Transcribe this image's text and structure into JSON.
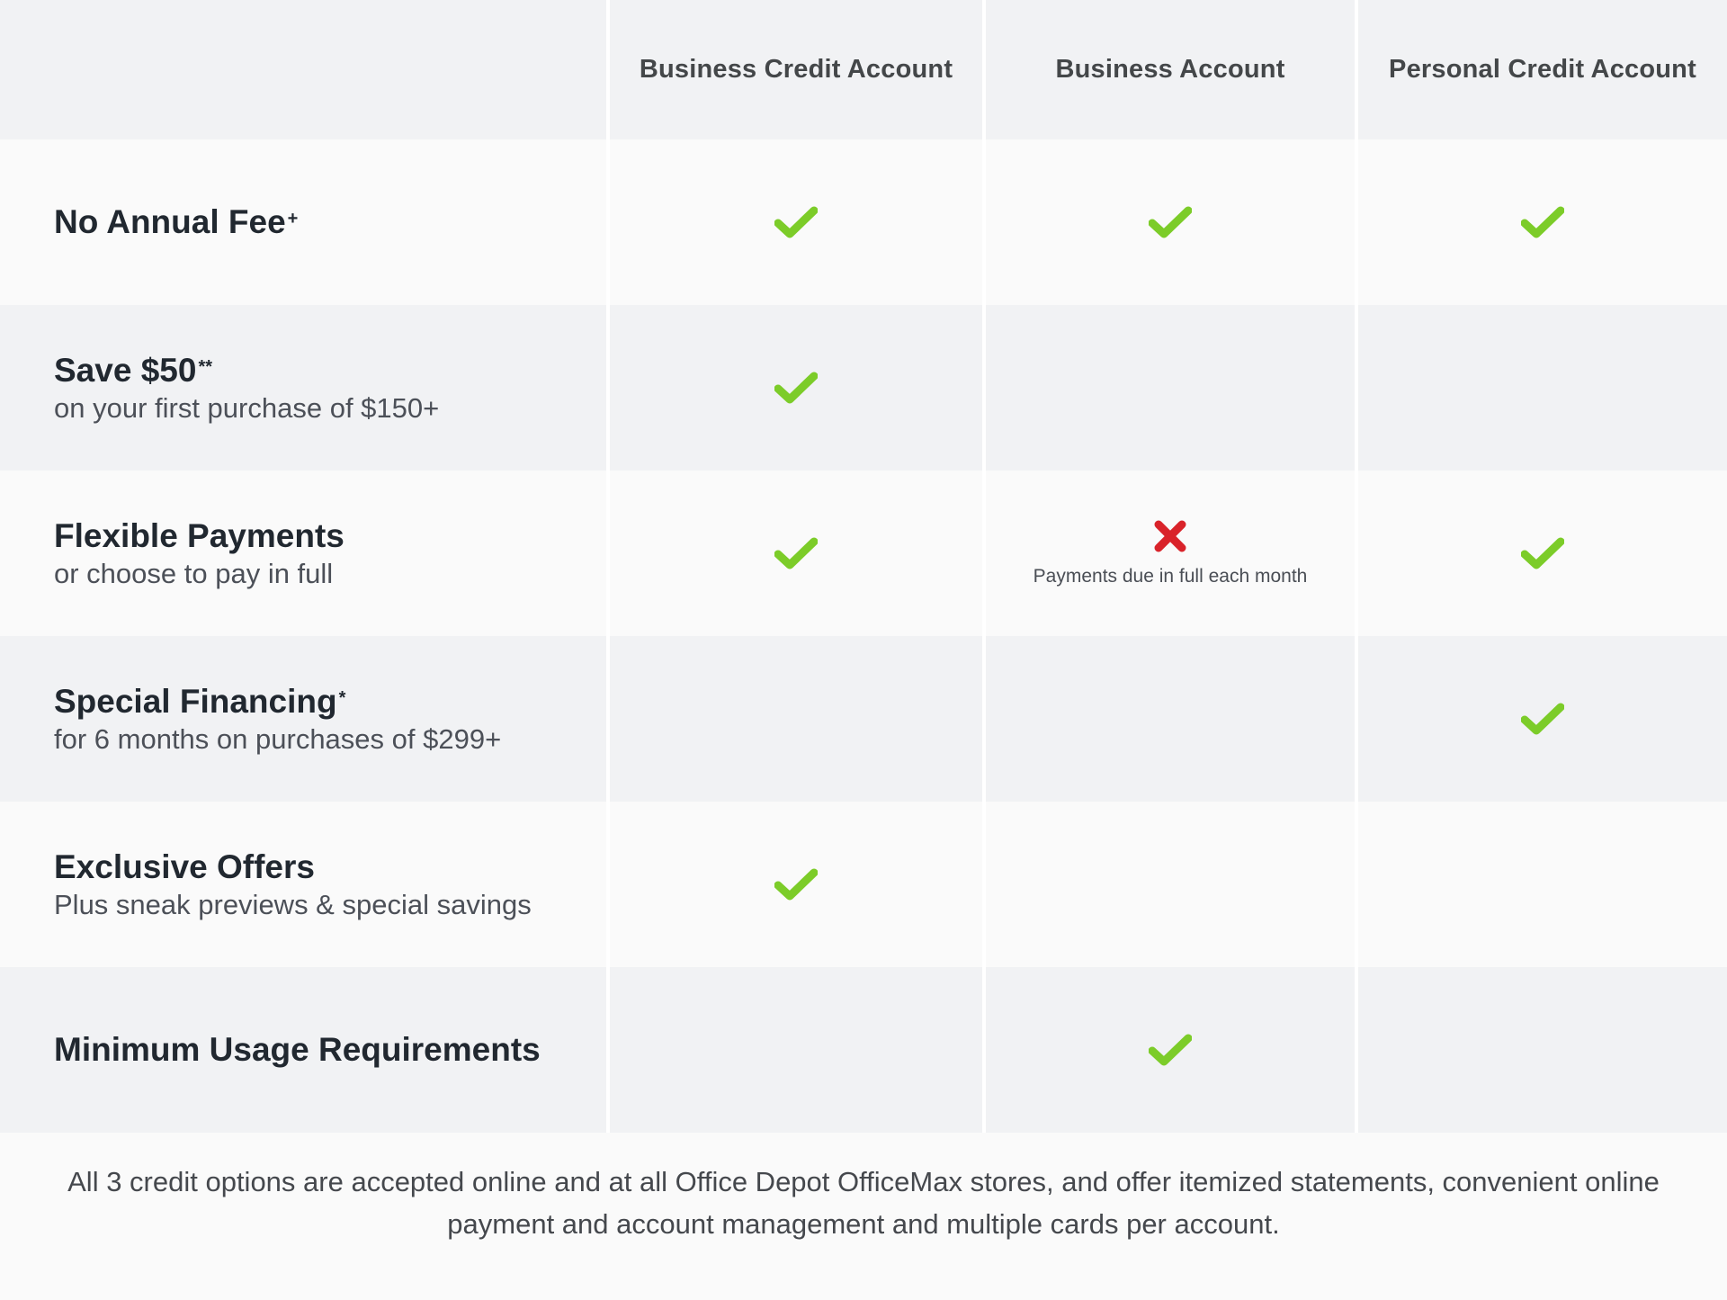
{
  "columns": [
    {
      "label": "Business Credit Account"
    },
    {
      "label": "Business Account"
    },
    {
      "label": "Personal Credit Account"
    }
  ],
  "colors": {
    "check": "#7ccc29",
    "cross": "#d9232a",
    "header_bg": "#f1f2f4",
    "row_light": "#fafafa",
    "row_dark": "#f1f2f4"
  },
  "rows": [
    {
      "title": "No Annual Fee",
      "marker": "+",
      "subtitle": "",
      "cells": [
        "check-icon",
        "check-icon",
        "check-icon"
      ],
      "notes": [
        "",
        "",
        ""
      ]
    },
    {
      "title": "Save $50",
      "marker": "**",
      "subtitle": "on your first purchase of $150+",
      "cells": [
        "check-icon",
        "",
        ""
      ],
      "notes": [
        "",
        "",
        ""
      ]
    },
    {
      "title": "Flexible Payments",
      "marker": "",
      "subtitle": "or choose to pay in full",
      "cells": [
        "check-icon",
        "cross-icon",
        "check-icon"
      ],
      "notes": [
        "",
        "Payments due in full each month",
        ""
      ]
    },
    {
      "title": "Special Financing",
      "marker": "*",
      "subtitle": "for 6 months on purchases of $299+",
      "cells": [
        "",
        "",
        "check-icon"
      ],
      "notes": [
        "",
        "",
        ""
      ]
    },
    {
      "title": "Exclusive Offers",
      "marker": "",
      "subtitle": "Plus sneak previews & special savings",
      "cells": [
        "check-icon",
        "",
        ""
      ],
      "notes": [
        "",
        "",
        ""
      ]
    },
    {
      "title": "Minimum Usage Requirements",
      "marker": "",
      "subtitle": "",
      "cells": [
        "",
        "check-icon",
        ""
      ],
      "notes": [
        "",
        "",
        ""
      ]
    }
  ],
  "footer": {
    "text": "All 3 credit options are accepted online and at all Office Depot OfficeMax stores, and offer itemized statements, convenient online payment and account management and multiple cards per account."
  }
}
